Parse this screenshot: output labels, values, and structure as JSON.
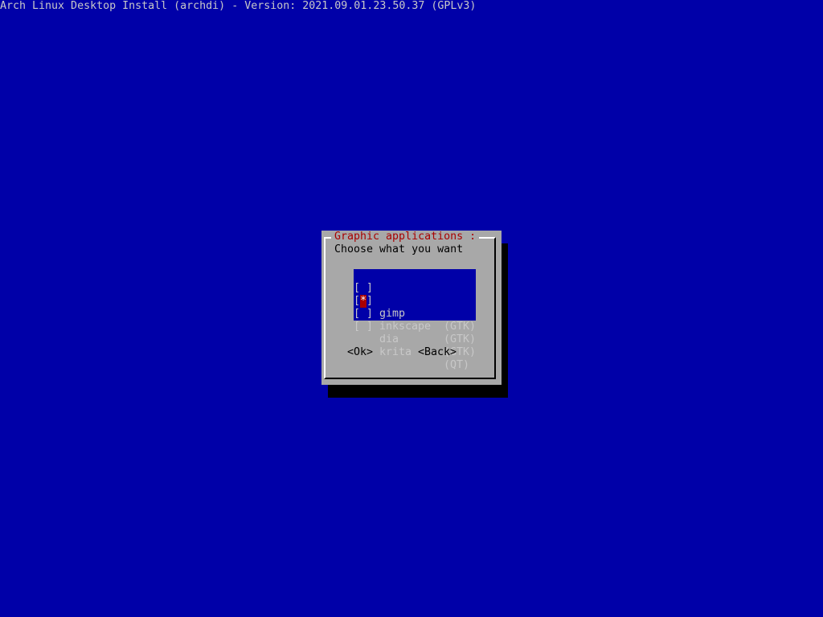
{
  "backtitle": "Arch Linux Desktop Install (archdi) - Version: 2021.09.01.23.50.37 (GPLv3)",
  "dialog": {
    "title": "Graphic applications :",
    "prompt": "Choose what you want",
    "items": [
      {
        "box_open": "[",
        "mark": "*",
        "box_close": "]",
        "name": "gimp",
        "desc": "(GTK)",
        "checked": true
      },
      {
        "box_open": "[",
        "mark": " ",
        "box_close": "]",
        "name": "inkscape",
        "desc": "(GTK)",
        "checked": false
      },
      {
        "box_open": "[",
        "mark": " ",
        "box_close": "]",
        "name": "dia",
        "desc": "(GTK)",
        "checked": false
      },
      {
        "box_open": "[",
        "mark": " ",
        "box_close": "]",
        "name": "krita",
        "desc": "(QT)",
        "checked": false
      }
    ],
    "ok_label": "<Ok>",
    "back_label": "<Back>"
  },
  "colors": {
    "background": "#0000a8",
    "dialog": "#a8a8a8",
    "title": "#a80000",
    "shadow": "#000000"
  }
}
